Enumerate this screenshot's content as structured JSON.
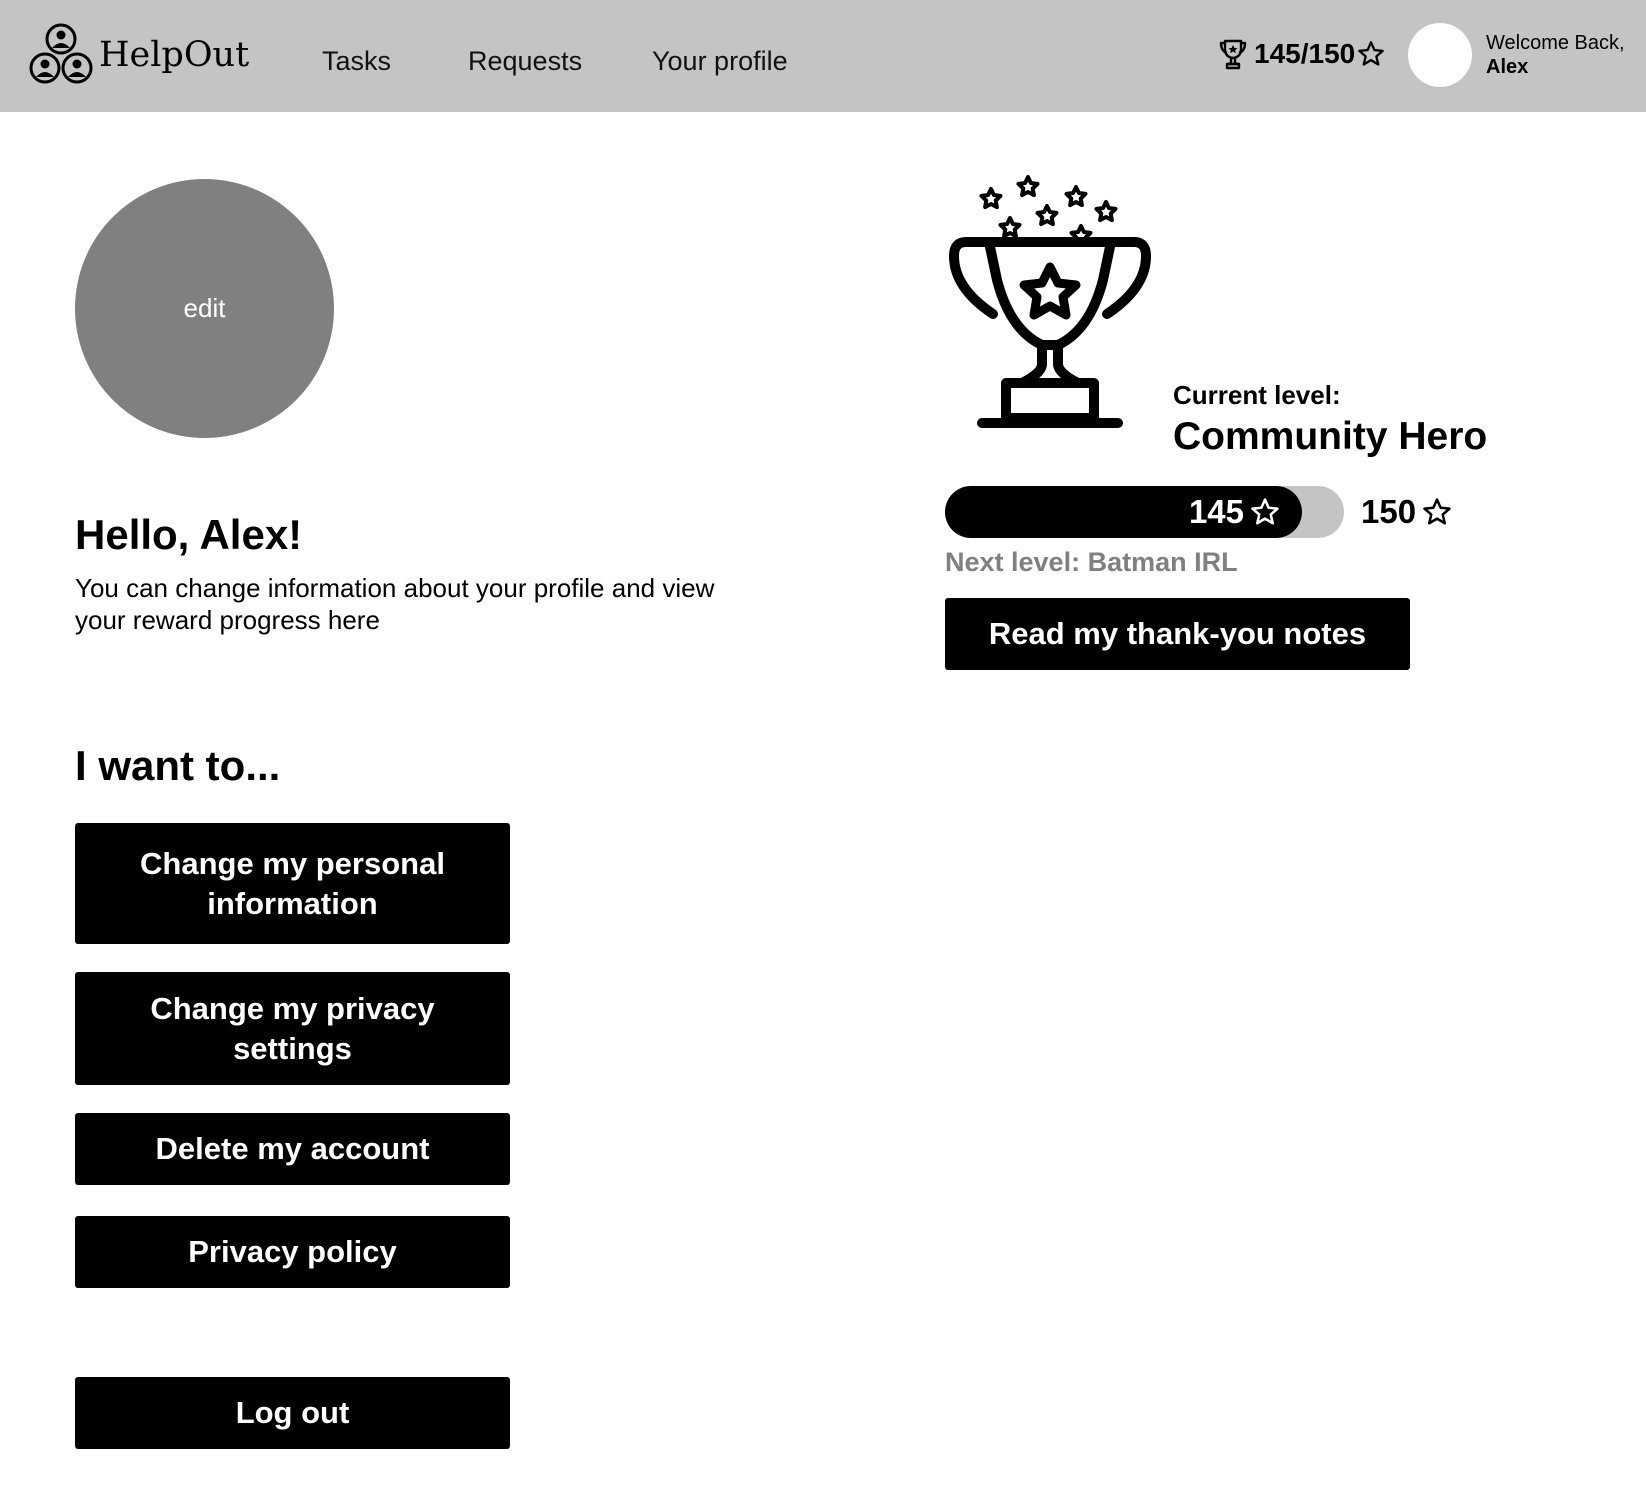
{
  "header": {
    "logo_text": "HelpOut",
    "nav": [
      "Tasks",
      "Requests",
      "Your profile"
    ],
    "points": "145/150",
    "welcome_line": "Welcome Back,",
    "user_name": "Alex"
  },
  "profile": {
    "avatar_edit": "edit",
    "greeting": "Hello, Alex!",
    "subtitle": "You can change information about your profile and view your reward progress here"
  },
  "actions": {
    "heading": "I want to...",
    "change_personal": "Change my personal information",
    "change_privacy": "Change my privacy settings",
    "delete_account": "Delete my account",
    "privacy_policy": "Privacy policy",
    "log_out": "Log out"
  },
  "rewards": {
    "current_label": "Current level:",
    "current_level": "Community Hero",
    "points": 145,
    "goal": 150,
    "points_label": "145",
    "goal_label": "150",
    "next_level": "Next level: Batman IRL",
    "notes_button": "Read my thank-you notes"
  },
  "colors": {
    "header_bg": "#c4c4c4",
    "button_bg": "#000000",
    "avatar_bg": "#808080",
    "muted_text": "#808080"
  }
}
